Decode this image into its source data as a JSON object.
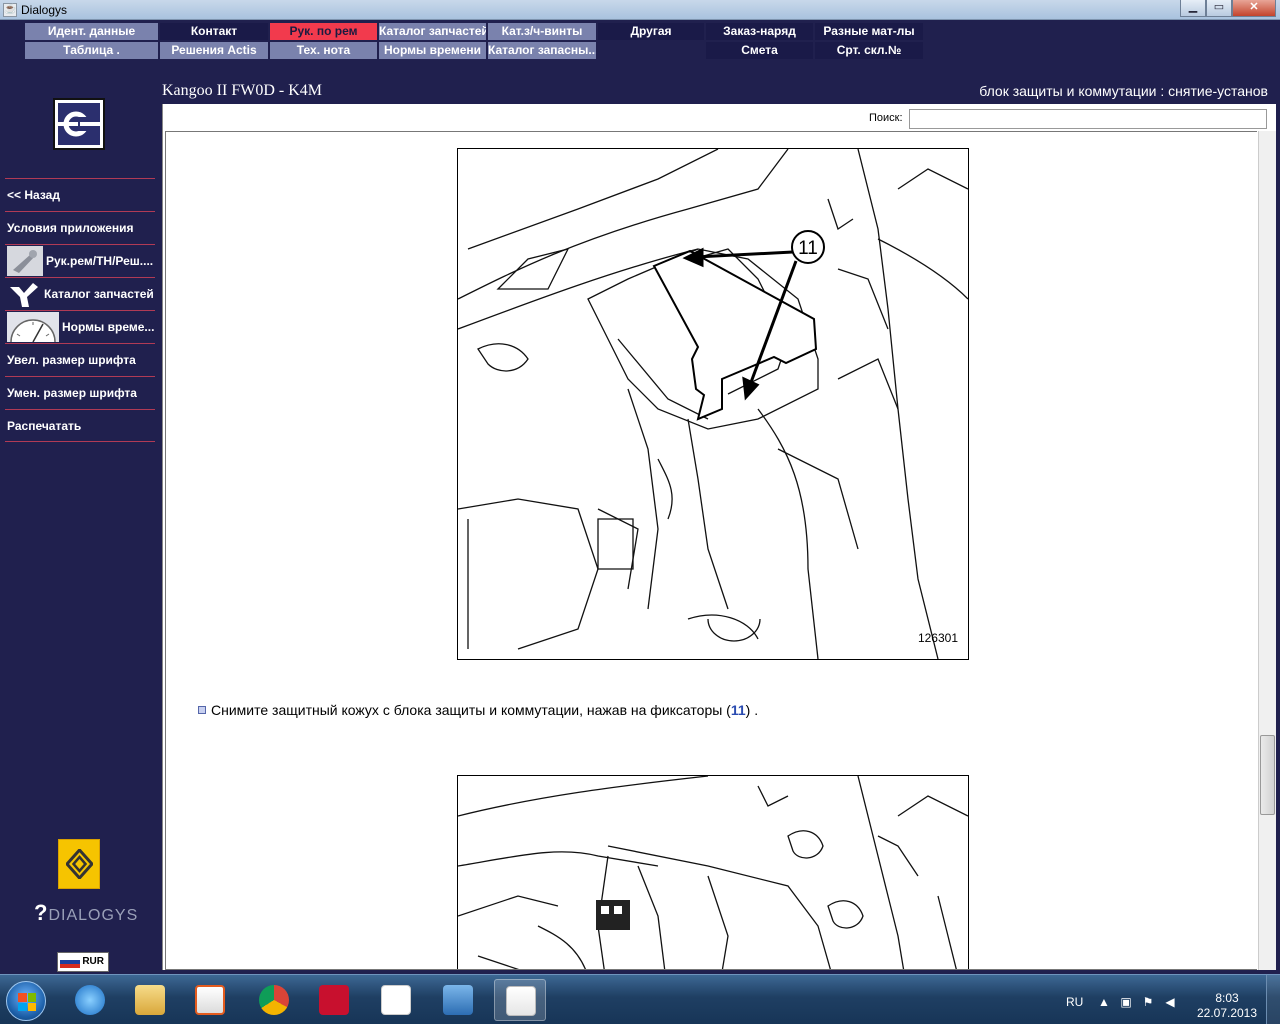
{
  "window": {
    "title": "Dialogys",
    "buttons": {
      "minimize": "▁",
      "maximize": "▭",
      "close": "✕"
    }
  },
  "topmenu": {
    "row1": [
      "Идент. данные",
      "Контакт",
      "Рук. по рем",
      "Каталог запчастей",
      "Кат.з/ч-винты",
      "Другая",
      "Заказ-наряд",
      "Разные мат-лы"
    ],
    "row2": [
      "Таблица .",
      "Решения Actis",
      "Тех. нота",
      "Нормы времени",
      "Каталог запасны...",
      "Смета",
      "Срт. скл.№"
    ],
    "active": "Рук. по рем"
  },
  "sidebar": {
    "items": [
      {
        "label": "<< Назад"
      },
      {
        "label": "Условия приложения"
      },
      {
        "label": "Рук.рем/ТН/Реш...."
      },
      {
        "label": "Каталог запчастей"
      },
      {
        "label": "Нормы време..."
      },
      {
        "label": "Увел. размер шрифта"
      },
      {
        "label": "Умен. размер шрифта"
      },
      {
        "label": "Распечатать"
      }
    ],
    "brand": "DIALOGYS",
    "brand_mark": "?",
    "currency": "RUR"
  },
  "header": {
    "vehicle": "Kangoo II FW0D - K4M",
    "document": "блок защиты и коммутации : снятие-установ"
  },
  "search": {
    "label": "Поиск:",
    "value": ""
  },
  "document": {
    "figure1_number": "126301",
    "callout": "11",
    "instruction_before": "Снимите защитный кожух с блока защиты и коммутации, нажав на фиксаторы (",
    "instruction_ref": "11",
    "instruction_after": ") ."
  },
  "taskbar": {
    "language": "RU",
    "time": "8:03",
    "date": "22.07.2013"
  },
  "colors": {
    "background": "#20204e",
    "menu_gray": "#7a82ad",
    "menu_active": "#f23a4d",
    "separator": "#b13a55"
  }
}
